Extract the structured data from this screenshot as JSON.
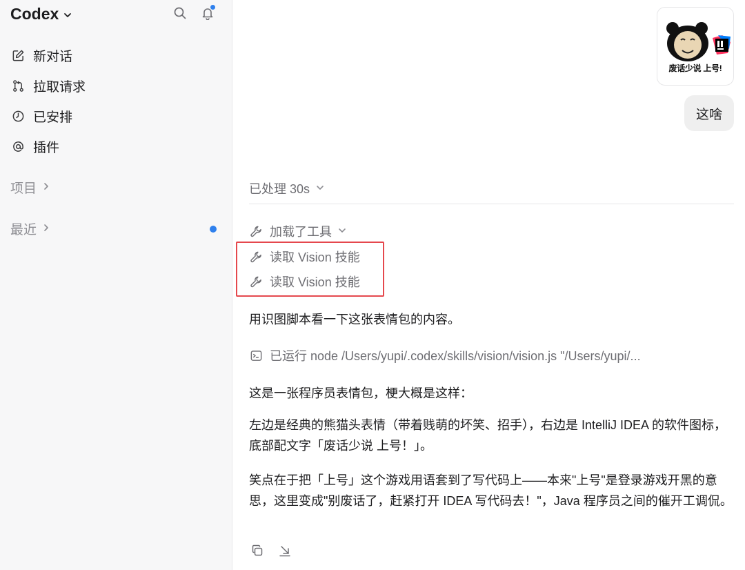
{
  "sidebar": {
    "brand": "Codex",
    "icons": {
      "search": "search-icon",
      "bell": "bell-icon"
    },
    "nav": [
      {
        "label": "新对话",
        "icon": "compose-icon"
      },
      {
        "label": "拉取请求",
        "icon": "pull-request-icon"
      },
      {
        "label": "已安排",
        "icon": "clock-icon"
      },
      {
        "label": "插件",
        "icon": "plugin-icon"
      }
    ],
    "projects_label": "项目",
    "recent_label": "最近"
  },
  "conversation": {
    "image_caption": "废话少说 上号!",
    "user_message": "这啥",
    "processed": "已处理 30s",
    "tools_loaded": "加载了工具",
    "tool_calls": [
      "读取 Vision 技能",
      "读取 Vision 技能"
    ],
    "paragraph_1": "用识图脚本看一下这张表情包的内容。",
    "command": "已运行 node /Users/yupi/.codex/skills/vision/vision.js \"/Users/yupi/...",
    "paragraph_2": "这是一张程序员表情包，梗大概是这样：",
    "paragraph_3": "左边是经典的熊猫头表情（带着贱萌的坏笑、招手），右边是 IntelliJ IDEA 的软件图标，底部配文字「废话少说 上号！」。",
    "paragraph_4": "笑点在于把「上号」这个游戏用语套到了写代码上——本来\"上号\"是登录游戏开黑的意思，这里变成\"别废话了，赶紧打开 IDEA 写代码去！\"，Java 程序员之间的催开工调侃。"
  },
  "colors": {
    "accent_dot": "#2f80ed",
    "highlight_border": "#e5484d",
    "sidebar_bg": "#f7f7f8",
    "bubble_bg": "#efefef"
  }
}
